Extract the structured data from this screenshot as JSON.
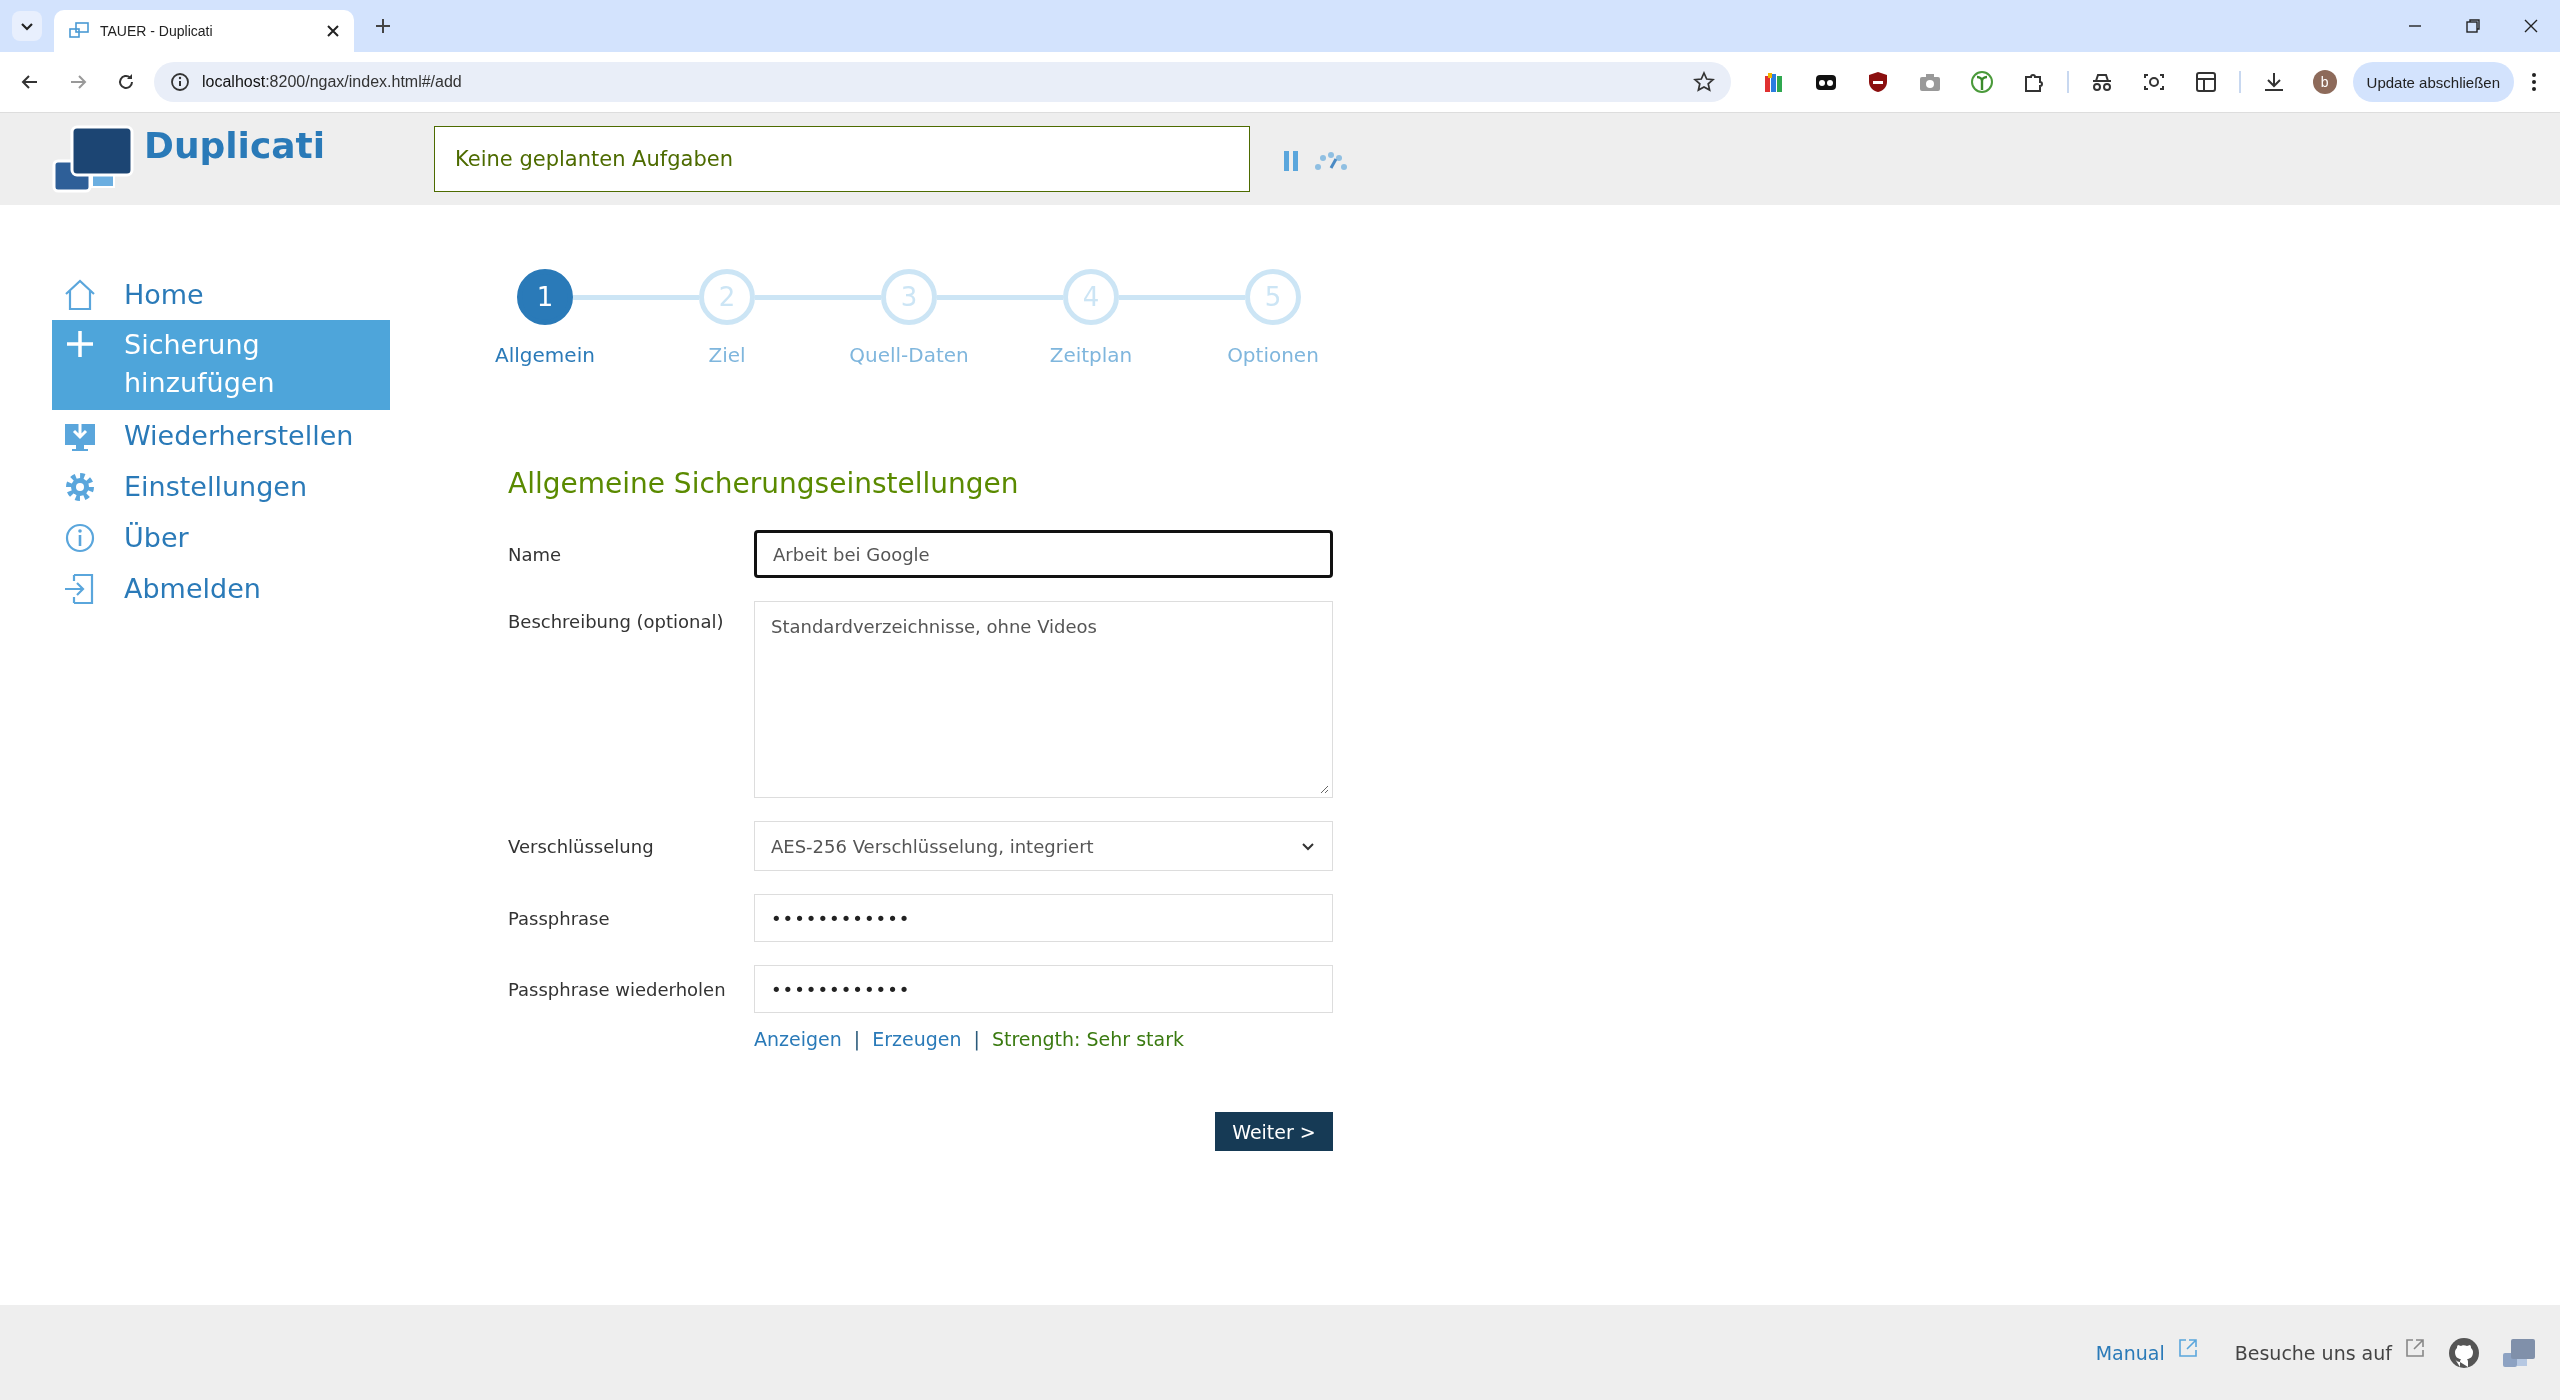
{
  "browser": {
    "tab_title": "TAUER - Duplicati",
    "url_host": "localhost",
    "url_rest": ":8200/ngax/index.html#/add",
    "profile_initial": "b",
    "update_button": "Update abschließen"
  },
  "header": {
    "app_name": "Duplicati",
    "status": "Keine geplanten Aufgaben"
  },
  "sidebar": {
    "items": [
      {
        "label": "Home",
        "kind": "home",
        "selected": false
      },
      {
        "label": "Sicherung hinzufügen",
        "kind": "plus",
        "selected": true
      },
      {
        "label": "Wiederherstellen",
        "kind": "restore",
        "selected": false
      },
      {
        "label": "Einstellungen",
        "kind": "gear",
        "selected": false
      },
      {
        "label": "Über",
        "kind": "info",
        "selected": false
      },
      {
        "label": "Abmelden",
        "kind": "logout",
        "selected": false
      }
    ]
  },
  "steps": [
    {
      "number": "1",
      "label": "Allgemein",
      "selected": true
    },
    {
      "number": "2",
      "label": "Ziel",
      "selected": false
    },
    {
      "number": "3",
      "label": "Quell-Daten",
      "selected": false
    },
    {
      "number": "4",
      "label": "Zeitplan",
      "selected": false
    },
    {
      "number": "5",
      "label": "Optionen",
      "selected": false
    }
  ],
  "form": {
    "heading": "Allgemeine Sicherungseinstellungen",
    "fields": [
      {
        "kind": "text",
        "label": "Name",
        "value": "Arbeit bei Google"
      },
      {
        "kind": "textarea",
        "label": "Beschreibung (optional)",
        "value": "Standardverzeichnisse, ohne Videos"
      },
      {
        "kind": "select",
        "label": "Verschlüsselung",
        "value": "AES-256 Verschlüsselung, integriert"
      },
      {
        "kind": "password",
        "label": "Passphrase",
        "value": "••••••••••••"
      },
      {
        "kind": "password",
        "label": "Passphrase wiederholen",
        "value": "••••••••••••"
      }
    ],
    "links": [
      {
        "kind": "link",
        "text": "Anzeigen"
      },
      {
        "kind": "separator",
        "text": "|"
      },
      {
        "kind": "link",
        "text": "Erzeugen"
      },
      {
        "kind": "separator",
        "text": "|"
      },
      {
        "kind": "strength",
        "text": "Strength: Sehr stark"
      }
    ],
    "next_button": "Weiter >"
  },
  "footer": {
    "manual": "Manual",
    "visit": "Besuche uns auf"
  }
}
